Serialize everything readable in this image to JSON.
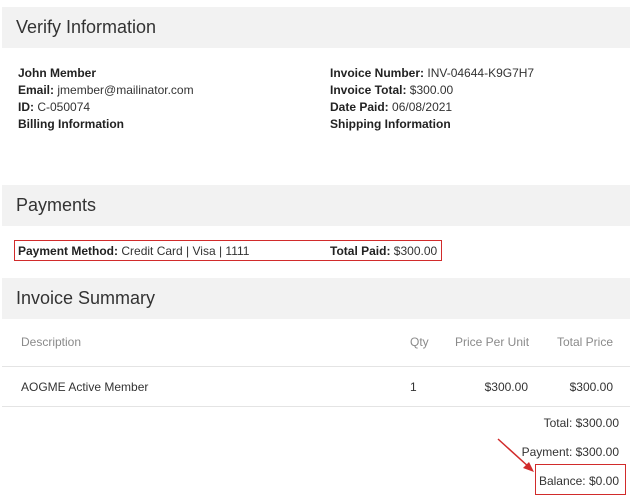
{
  "verify": {
    "title": "Verify Information",
    "member_name": "John Member",
    "email_label": "Email:",
    "email_value": "jmember@mailinator.com",
    "id_label": "ID:",
    "id_value": "C-050074",
    "billing_label": "Billing Information",
    "invoice_number_label": "Invoice Number:",
    "invoice_number_value": "INV-04644-K9G7H7",
    "invoice_total_label": "Invoice Total:",
    "invoice_total_value": "$300.00",
    "date_paid_label": "Date Paid:",
    "date_paid_value": "06/08/2021",
    "shipping_label": "Shipping Information"
  },
  "payments": {
    "title": "Payments",
    "method_label": "Payment Method:",
    "method_value": "Credit Card | Visa | 1111",
    "total_paid_label": "Total Paid:",
    "total_paid_value": "$300.00"
  },
  "summary": {
    "title": "Invoice Summary",
    "columns": [
      "Description",
      "Qty",
      "Price Per Unit",
      "Total Price"
    ],
    "rows": [
      {
        "description": "AOGME Active Member",
        "qty": "1",
        "price_per_unit": "$300.00",
        "total_price": "$300.00"
      }
    ],
    "total": "Total: $300.00",
    "payment": "Payment: $300.00",
    "balance": "Balance: $0.00"
  },
  "colors": {
    "highlight": "#d12b2b",
    "header_bg": "#f2f2f2"
  }
}
